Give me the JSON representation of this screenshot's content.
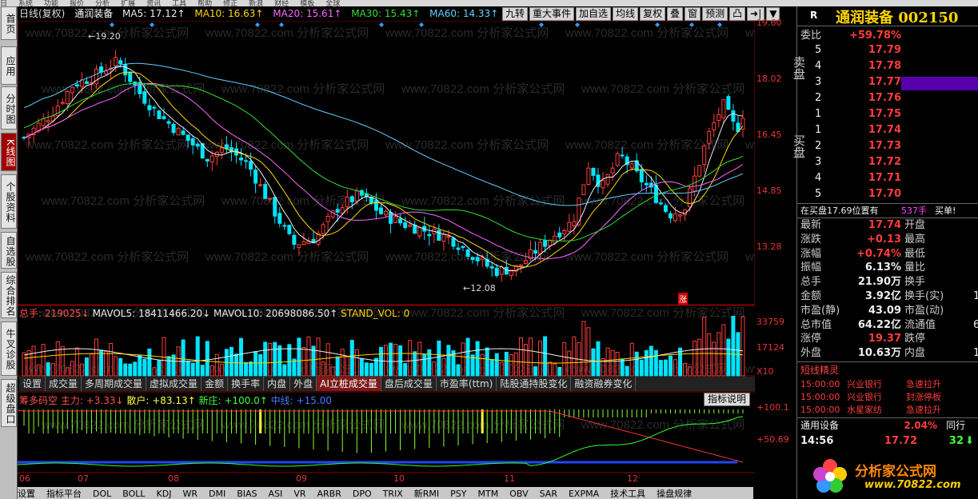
{
  "menubar": {
    "items": [
      "日",
      "系统",
      "功能",
      "报价",
      "分析",
      "扩展",
      "资讯",
      "工具",
      "帮助",
      "修正",
      "新浪",
      "财经",
      "模板",
      "全球"
    ]
  },
  "leftnav": [
    "首页",
    "应用",
    "分时图",
    "K线图",
    "个股资料",
    "自选股",
    "综合排名",
    "牛叉诊股",
    "超级盘口"
  ],
  "toolbar": {
    "period": "日线(复权)",
    "name": "通润装备",
    "ma5": "MA5: 17.12↑",
    "ma10": "MA10: 16.63↑",
    "ma20": "MA20: 15.61↑",
    "ma30": "MA30: 15.43↑",
    "ma60": "MA60: 14.33↑"
  },
  "rtools": [
    "九转",
    "重大事件",
    "加自选",
    "均线",
    "复权",
    "叠",
    "窗",
    "预测",
    "凸",
    "➜|",
    "▼"
  ],
  "price_axis": [
    "19.60",
    "18.02",
    "16.45",
    "14.85",
    "13.28"
  ],
  "vol_axis": [
    "33759",
    "17124",
    "X10"
  ],
  "ind_axis": [
    "+100.1",
    "+50.69"
  ],
  "annot": {
    "high": "←19.20",
    "low": "←12.08",
    "zhang": "涨"
  },
  "vol_header": {
    "total": "总手: 219025↓",
    "mavol5": "MAVOL5: 18411466.20↓",
    "mavol10": "MAVOL10: 20698086.50↑",
    "stand": "STAND_VOL: 0"
  },
  "subtabs": [
    "设置",
    "成交量",
    "多周期成交量",
    "虚拟成交量",
    "金额",
    "换手率",
    "内盘",
    "外盘",
    "AI立桩成交量",
    "盘后成交量",
    "市盈率(ttm)",
    "陆股通持股变化",
    "融资融券变化"
  ],
  "ind_header": {
    "name": "筹多码空",
    "main": "主力: +3.33↓",
    "retail": "散户: +83.13↑",
    "new": "新庄: +100.0↑",
    "mid": "中线: +15.00"
  },
  "ind_desc": "指标说明",
  "date_axis": [
    "06",
    "07",
    "08",
    "09",
    "10",
    "11",
    "12"
  ],
  "bottom_tabs": [
    "设置",
    "指标平台",
    "DOL",
    "BOLL",
    "KDJ",
    "WR",
    "DMI",
    "BIAS",
    "ASI",
    "VR",
    "ARBR",
    "DPO",
    "TRIX",
    "新RMI",
    "PSY",
    "MTM",
    "OBV",
    "SAR",
    "EXPMA",
    "技术工具",
    "操盘规律"
  ],
  "watermark": "www.70822.com 分析家公式网",
  "right": {
    "title": "通润装备 002150",
    "rmark": "R",
    "weibi_label": "委比",
    "weibi": "+59.78%",
    "sell_label": "卖盘",
    "buy_label": "买盘",
    "sells": [
      {
        "n": "5",
        "p": "17.79"
      },
      {
        "n": "4",
        "p": "17.78"
      },
      {
        "n": "3",
        "p": "17.77"
      },
      {
        "n": "2",
        "p": "17.76"
      },
      {
        "n": "1",
        "p": "17.75"
      }
    ],
    "buys": [
      {
        "n": "1",
        "p": "17.74"
      },
      {
        "n": "2",
        "p": "17.73"
      },
      {
        "n": "3",
        "p": "17.72"
      },
      {
        "n": "4",
        "p": "17.71"
      },
      {
        "n": "5",
        "p": "17.70"
      }
    ],
    "note": "在买盘17.69位置有",
    "note_qty": "537手",
    "note_act": "买单!",
    "stats": [
      {
        "l1": "最新",
        "v1": "17.74",
        "l2": "开盘",
        "v2": ""
      },
      {
        "l1": "涨跌",
        "v1": "+0.13",
        "l2": "最高",
        "v2": ""
      },
      {
        "l1": "涨幅",
        "v1": "+0.74%",
        "l2": "最低",
        "v2": ""
      },
      {
        "l1": "振幅",
        "v1": "6.13%",
        "l2": "量比",
        "v2": ""
      },
      {
        "l1": "总手",
        "v1": "21.90万",
        "l2": "换手",
        "v2": ""
      },
      {
        "l1": "金额",
        "v1": "3.92亿",
        "l2": "换手(实)",
        "v2": "1"
      },
      {
        "l1": "市盈(静)",
        "v1": "43.09",
        "l2": "市盈(动)",
        "v2": ""
      },
      {
        "l1": "总市值",
        "v1": "64.22亿",
        "l2": "流通值",
        "v2": "6"
      },
      {
        "l1": "涨停",
        "v1": "19.37",
        "l2": "跌停",
        "v2": ""
      },
      {
        "l1": "外盘",
        "v1": "10.63万",
        "l2": "内盘",
        "v2": "1"
      }
    ],
    "spirit_title": "短线精灵",
    "spirit": [
      {
        "t": "15:00:00",
        "s": "兴业银行",
        "e": "急速拉升"
      },
      {
        "t": "15:00:00",
        "s": "兴业银行",
        "e": "封涨停板"
      },
      {
        "t": "15:00:00",
        "s": "水星家纺",
        "e": "急速拉升"
      }
    ],
    "industry": "通用设备",
    "industry_pct": "2.04%",
    "industry_more": "同行",
    "tick": {
      "time": "14:56",
      "price": "17.72",
      "vol": "32"
    },
    "logo_text": "分析家公式网",
    "logo_url": "www.70822.com"
  },
  "chart_data": {
    "type": "candlestick",
    "note_candles": "approximate daily candles, ~150 bars",
    "price_range": [
      11.6,
      20.1
    ],
    "high_label": 19.2,
    "low_label": 12.08
  }
}
